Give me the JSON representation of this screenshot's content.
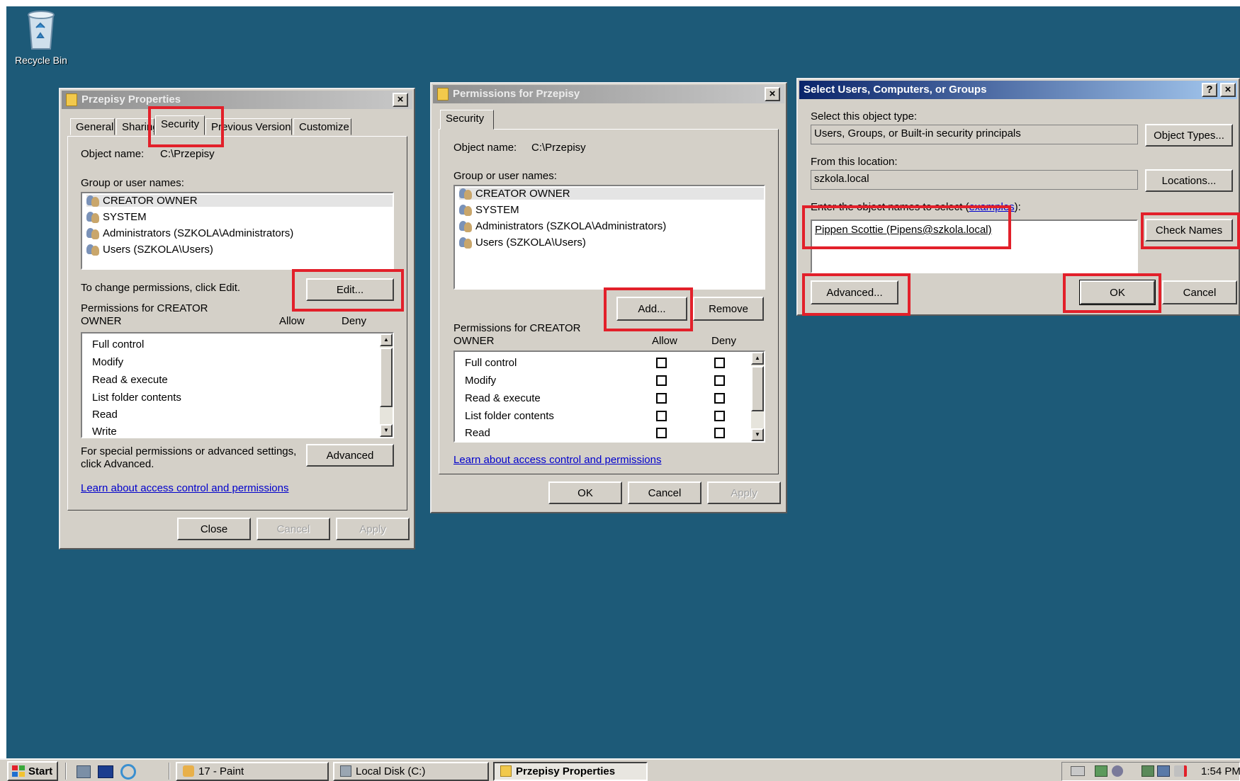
{
  "desktop": {
    "recycle_bin_label": "Recycle Bin"
  },
  "props_window": {
    "title": "Przepisy Properties",
    "close_glyph": "×",
    "tabs": [
      "General",
      "Sharing",
      "Security",
      "Previous Versions",
      "Customize"
    ],
    "object_name_label": "Object name:",
    "object_name_value": "C:\\Przepisy",
    "group_label": "Group or user names:",
    "users": [
      "CREATOR OWNER",
      "SYSTEM",
      "Administrators (SZKOLA\\Administrators)",
      "Users (SZKOLA\\Users)"
    ],
    "change_text": "To change permissions, click Edit.",
    "edit_button": "Edit...",
    "perms_label_1": "Permissions for CREATOR",
    "perms_label_2": "OWNER",
    "allow_label": "Allow",
    "deny_label": "Deny",
    "permissions": [
      "Full control",
      "Modify",
      "Read & execute",
      "List folder contents",
      "Read",
      "Write"
    ],
    "special_text_1": "For special permissions or advanced settings,",
    "special_text_2": "click Advanced.",
    "advanced_button": "Advanced",
    "learn_link": "Learn about access control and permissions",
    "close_button": "Close",
    "cancel_button": "Cancel",
    "apply_button": "Apply"
  },
  "perm_window": {
    "title": "Permissions for Przepisy",
    "close_glyph": "×",
    "tab": "Security",
    "object_name_label": "Object name:",
    "object_name_value": "C:\\Przepisy",
    "group_label": "Group or user names:",
    "users": [
      "CREATOR OWNER",
      "SYSTEM",
      "Administrators (SZKOLA\\Administrators)",
      "Users (SZKOLA\\Users)"
    ],
    "add_button": "Add...",
    "remove_button": "Remove",
    "perms_label_1": "Permissions for CREATOR",
    "perms_label_2": "OWNER",
    "allow_label": "Allow",
    "deny_label": "Deny",
    "permissions": [
      "Full control",
      "Modify",
      "Read & execute",
      "List folder contents",
      "Read"
    ],
    "learn_link": "Learn about access control and permissions",
    "ok_button": "OK",
    "cancel_button": "Cancel",
    "apply_button": "Apply"
  },
  "select_window": {
    "title": "Select Users, Computers, or Groups",
    "help_glyph": "?",
    "close_glyph": "×",
    "object_type_label": "Select this object type:",
    "object_type_value": "Users, Groups, or Built-in security principals",
    "object_types_button": "Object Types...",
    "location_label": "From this location:",
    "location_value": "szkola.local",
    "locations_button": "Locations...",
    "enter_label": "Enter the object names to select",
    "examples_link": "examples",
    "names_value": "Pippen Scottie (Pipens@szkola.local)",
    "check_names_button": "Check Names",
    "advanced_button": "Advanced...",
    "ok_button": "OK",
    "cancel_button": "Cancel"
  },
  "taskbar": {
    "start_label": "Start",
    "tasks": [
      "17 - Paint",
      "Local Disk (C:)",
      "Przepisy Properties"
    ],
    "clock": "1:54 PM"
  },
  "colors": {
    "desktop": "#1d5a78",
    "highlight": "#e2202a",
    "link": "#0000cc"
  }
}
